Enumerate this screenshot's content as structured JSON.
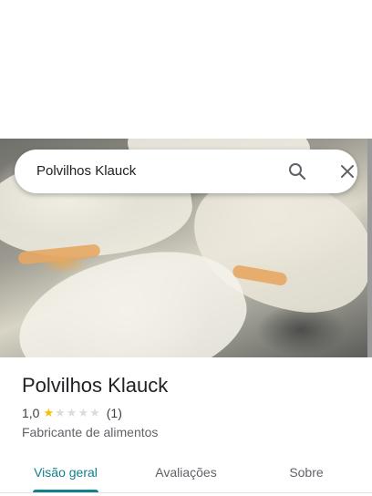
{
  "search": {
    "value": "Polvilhos Klauck"
  },
  "place": {
    "name": "Polvilhos Klauck",
    "rating_text": "1,0",
    "rating_value": 1,
    "rating_max": 5,
    "review_count": "(1)",
    "category": "Fabricante de alimentos"
  },
  "tabs": [
    {
      "label": "Visão geral",
      "active": true
    },
    {
      "label": "Avaliações",
      "active": false
    },
    {
      "label": "Sobre",
      "active": false
    }
  ],
  "colors": {
    "accent": "#11808c",
    "star_filled": "#fbbc04",
    "star_empty": "#dadce0"
  },
  "icons": {
    "search": "search-icon",
    "close": "close-icon"
  }
}
